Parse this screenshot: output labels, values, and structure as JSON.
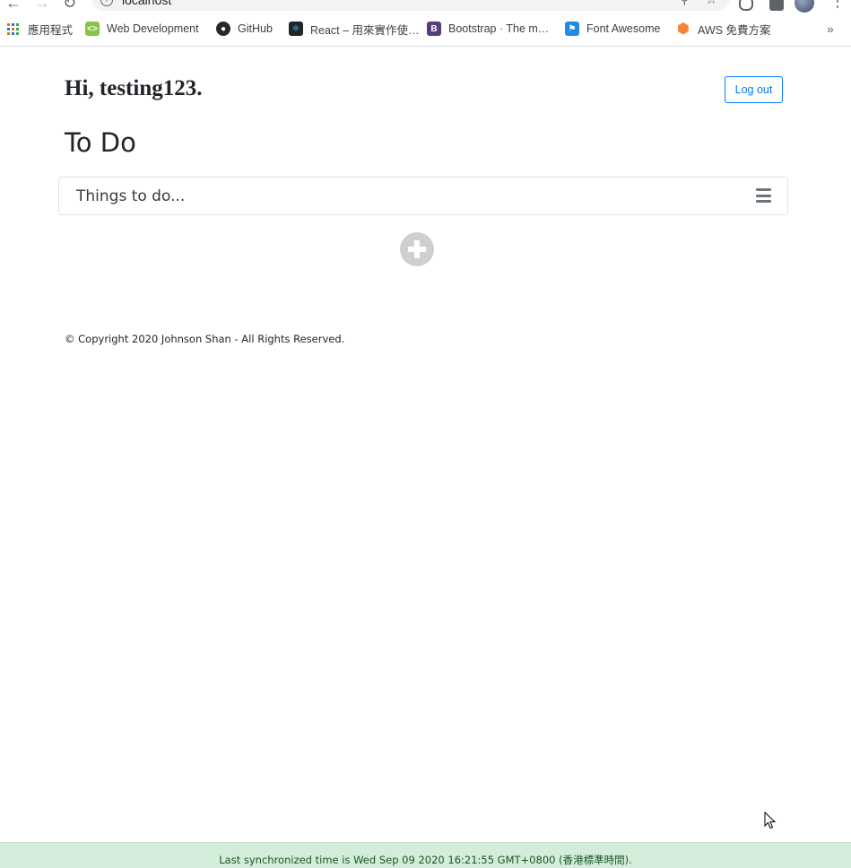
{
  "browser": {
    "url": "localhost",
    "bookmarks": [
      {
        "label": "應用程式",
        "icon": "apps-grid-icon"
      },
      {
        "label": "Web Development",
        "icon": "webdev-icon",
        "color": "#8bc34a"
      },
      {
        "label": "GitHub",
        "icon": "github-icon",
        "color": "#24292e"
      },
      {
        "label": "React – 用來實作使…",
        "icon": "react-icon",
        "color": "#20232a"
      },
      {
        "label": "Bootstrap · The m…",
        "icon": "bootstrap-icon",
        "color": "#563d7c"
      },
      {
        "label": "Font Awesome",
        "icon": "flag-icon",
        "color": "#228ae6"
      },
      {
        "label": "AWS 免費方案",
        "icon": "aws-hexagon-icon",
        "color": "#f58536"
      }
    ],
    "more_label": "»"
  },
  "header": {
    "greeting": "Hi, testing123.",
    "logout_label": "Log out"
  },
  "main": {
    "title": "To Do",
    "input_placeholder": "Things to do...",
    "menu_icon": "bars-icon",
    "add_icon": "plus-circle-icon"
  },
  "footer": {
    "copyright": "© Copyright 2020 Johnson Shan - All Rights Reserved."
  },
  "status": {
    "text": "Last synchronized time is Wed Sep 09 2020 16:21:55 GMT+0800 (香港標準時間).",
    "background": "#d4edda",
    "color": "#155724"
  },
  "colors": {
    "accent": "#007bff",
    "add_button": "#cfcfcf"
  }
}
